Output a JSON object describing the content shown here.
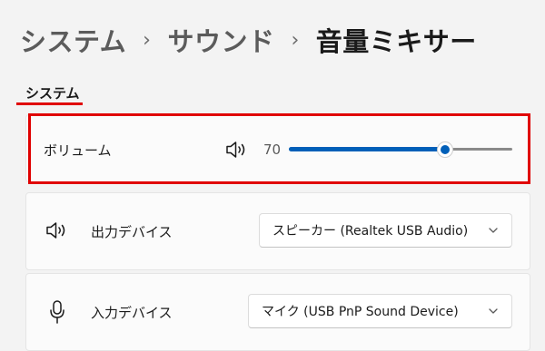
{
  "breadcrumb": {
    "items": [
      "システム",
      "サウンド"
    ],
    "current": "音量ミキサー",
    "separator": "›"
  },
  "section": {
    "title": "システム"
  },
  "volume": {
    "label": "ボリューム",
    "value_text": "70",
    "level_percent": 70,
    "icon": "speaker-icon"
  },
  "output_device": {
    "label": "出力デバイス",
    "icon": "speaker-icon",
    "selected": "スピーカー (Realtek USB Audio)"
  },
  "input_device": {
    "label": "入力デバイス",
    "icon": "microphone-icon",
    "selected": "マイク (USB PnP Sound Device)"
  },
  "colors": {
    "accent": "#005fb8",
    "highlight": "#e00000",
    "background": "#f3f3f3",
    "card": "#fbfbfb"
  }
}
